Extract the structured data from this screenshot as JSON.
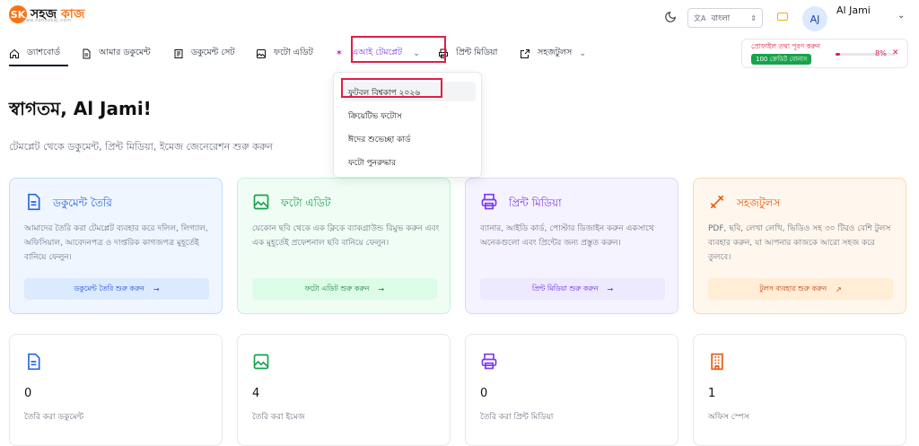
{
  "logo": {
    "mark": "SK",
    "text_a": "সহজ ",
    "text_b": "কাজ",
    "sub": "www.sohozkaj.com"
  },
  "header": {
    "language": {
      "icon_text": "文A",
      "value": "বাংলা"
    },
    "avatar_initials": "AJ",
    "user_name": "Al Jami"
  },
  "nav": {
    "items": [
      {
        "label": "ড্যাশবোর্ড",
        "icon": "home-icon"
      },
      {
        "label": "আমার ডকুমেন্ট",
        "icon": "document-icon"
      },
      {
        "label": "ডকুমেন্ট সেট",
        "icon": "document-set-icon"
      },
      {
        "label": "ফটো এডিট",
        "icon": "image-icon"
      },
      {
        "label": "এআই টেমপ্লেট",
        "icon": "magic-wand-icon"
      },
      {
        "label": "প্রিন্ট মিডিয়া",
        "icon": "printer-icon"
      },
      {
        "label": "সহজটুলস",
        "icon": "external-link-icon"
      }
    ]
  },
  "promo": {
    "title": "প্রোফাইল তথ্য পূরণ করুন",
    "badge": "100 ক্রেডিট বোনাস",
    "percent_text": "8%",
    "percent": 8,
    "close": "✕"
  },
  "dropdown": {
    "items": [
      "ফুটবল বিশ্বকাপ ২০২৬",
      "ক্রিয়েটিভ ফটোস",
      "ঈদের শুভেচ্ছা কার্ড",
      "ফটো পুনরুদ্ধার"
    ]
  },
  "main": {
    "welcome": "স্বাগতম, Al Jami!",
    "subtitle": "টেমপ্লেট থেকে ডকুমেন্ট, প্রিন্ট মিডিয়া, ইমেজ জেনেরেশন শুরু করুন"
  },
  "cards": [
    {
      "title": "ডকুমেন্ট তৈরি",
      "desc": "আমাদের তৈরি করা টেমপ্লেট ব্যবহার করে দলিল, লিগ্যাল, অফিসিয়াল, আবেদনপত্র ও দাপ্তরিক কাগজপত্র মুহূর্তেই বানিয়ে ফেলুন।",
      "button": "ডকুমেন্ট তৈরি শুরু করুন",
      "button_icon": "→"
    },
    {
      "title": "ফটো এডিট",
      "desc": "যেকোন ছবি থেকে এক ক্লিকে ব্যাকগ্রাউন্ড রিমুভ করুন এবং এক মুহূর্তেই প্রফেশনাল ছবি বানিয়ে ফেলুন।",
      "button": "ফটো এডিট শুরু করুন",
      "button_icon": "→"
    },
    {
      "title": "প্রিন্ট মিডিয়া",
      "desc": "ব্যানার, আইডি কার্ড, পোস্টার ডিজাইন করুন একসাথে অনেকগুলো এবং প্রিন্টের জন্য প্রস্তুত করুন।",
      "button": "প্রিন্ট মিডিয়া শুরু করুন",
      "button_icon": "→"
    },
    {
      "title": "সহজটুলস",
      "desc": "PDF, ছবি, লেখা লেখি, ভিডিও সহ ৩০ টিরও বেশি টুলস ব্যবহার করুন, যা আপনার কাজকে আরো সহজ করে তুলবে।",
      "button": "টুলস ব্যবহার শুরু করুন",
      "button_icon": "↗"
    }
  ],
  "stats": [
    {
      "value": "0",
      "label": "তৈরি করা ডকুমেন্ট"
    },
    {
      "value": "4",
      "label": "তৈরি করা ইমেজ"
    },
    {
      "value": "0",
      "label": "তৈরি করা প্রিন্ট মিডিয়া"
    },
    {
      "value": "1",
      "label": "অফিস স্পেস"
    }
  ]
}
